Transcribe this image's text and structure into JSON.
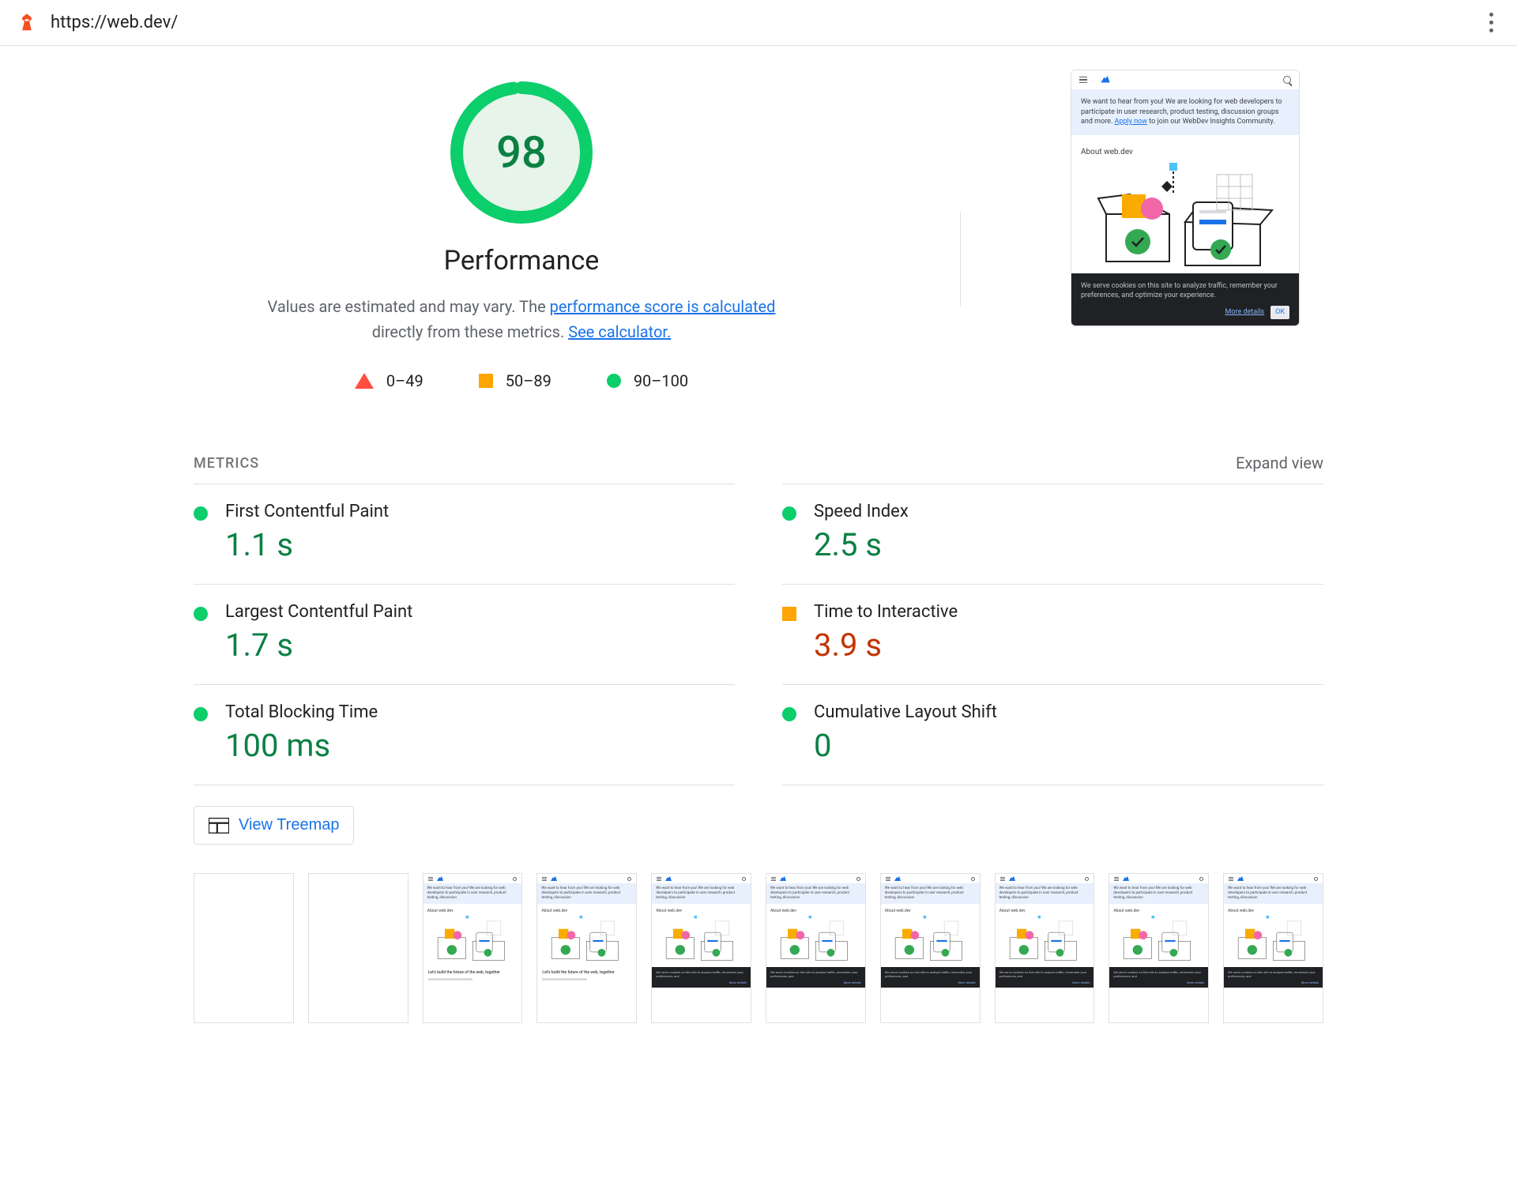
{
  "header": {
    "url": "https://web.dev/"
  },
  "score": {
    "value": "98",
    "label": "Performance",
    "description_prefix": "Values are estimated and may vary. The ",
    "link1": "performance score is calculated",
    "description_mid": " directly from these metrics. ",
    "link2": "See calculator."
  },
  "legend": {
    "fail": "0–49",
    "avg": "50–89",
    "pass": "90–100"
  },
  "metrics_header": {
    "title": "METRICS",
    "expand": "Expand view"
  },
  "metrics": [
    {
      "name": "First Contentful Paint",
      "value": "1.1 s",
      "status": "green"
    },
    {
      "name": "Speed Index",
      "value": "2.5 s",
      "status": "green"
    },
    {
      "name": "Largest Contentful Paint",
      "value": "1.7 s",
      "status": "green"
    },
    {
      "name": "Time to Interactive",
      "value": "3.9 s",
      "status": "orange"
    },
    {
      "name": "Total Blocking Time",
      "value": "100 ms",
      "status": "green"
    },
    {
      "name": "Cumulative Layout Shift",
      "value": "0",
      "status": "green"
    }
  ],
  "treemap_label": "View Treemap",
  "preview": {
    "banner_text": "We want to hear from you! We are looking for web developers to participate in user research, product testing, discussion groups and more. ",
    "banner_link": "Apply now",
    "banner_suffix": " to join our WebDev Insights Community.",
    "about": "About web.dev",
    "cookie_text": "We serve cookies on this site to analyze traffic, remember your preferences, and optimize your experience.",
    "more_details": "More details",
    "ok": "OK"
  },
  "filmstrip_text": {
    "tag": "Let's build the future of the web, together"
  }
}
